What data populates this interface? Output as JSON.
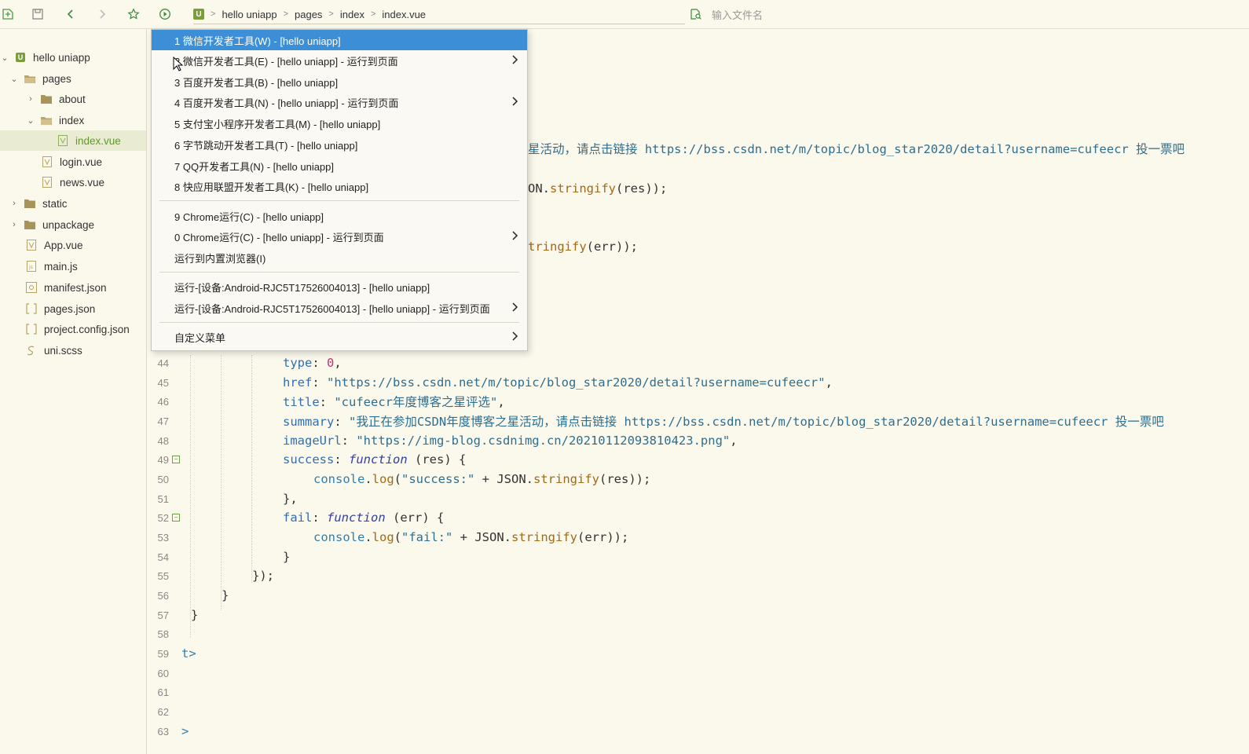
{
  "toolbar": {
    "breadcrumb": [
      "hello uniapp",
      "pages",
      "index",
      "index.vue"
    ],
    "file_search_placeholder": "输入文件名"
  },
  "sidebar": {
    "items": [
      {
        "label": "hello uniapp"
      },
      {
        "label": "pages"
      },
      {
        "label": "about"
      },
      {
        "label": "index"
      },
      {
        "label": "index.vue"
      },
      {
        "label": "login.vue"
      },
      {
        "label": "news.vue"
      },
      {
        "label": "static"
      },
      {
        "label": "unpackage"
      },
      {
        "label": "App.vue"
      },
      {
        "label": "main.js"
      },
      {
        "label": "manifest.json"
      },
      {
        "label": "pages.json"
      },
      {
        "label": "project.config.json"
      },
      {
        "label": "uni.scss"
      }
    ]
  },
  "menu": {
    "items": [
      {
        "label": "1 微信开发者工具(W) - [hello uniapp]"
      },
      {
        "label": "2 微信开发者工具(E) - [hello uniapp] - 运行到页面"
      },
      {
        "label": "3 百度开发者工具(B) - [hello uniapp]"
      },
      {
        "label": "4 百度开发者工具(N) - [hello uniapp] - 运行到页面"
      },
      {
        "label": "5 支付宝小程序开发者工具(M) - [hello uniapp]"
      },
      {
        "label": "6 字节跳动开发者工具(T) - [hello uniapp]"
      },
      {
        "label": "7 QQ开发者工具(N) - [hello uniapp]"
      },
      {
        "label": "8 快应用联盟开发者工具(K) - [hello uniapp]"
      },
      {
        "label": "9 Chrome运行(C) - [hello uniapp]"
      },
      {
        "label": "0 Chrome运行(C) - [hello uniapp] - 运行到页面"
      },
      {
        "label": "运行到内置浏览器(I)"
      },
      {
        "label": "运行-[设备:Android-RJC5T17526004013] - [hello uniapp]"
      },
      {
        "label": "运行-[设备:Android-RJC5T17526004013] - [hello uniapp] - 运行到页面"
      },
      {
        "label": "自定义菜单"
      }
    ]
  },
  "editor": {
    "partial": {
      "line1": "星活动，请点击链接 https://bss.csdn.net/m/topic/blog_star2020/detail?username=cufeecr 投一票吧",
      "line2a": "ON.",
      "line2b": "stringify",
      "line2c": "(res));",
      "line3a": "tringify",
      "line3b": "(err));"
    },
    "line_numbers": [
      "44",
      "45",
      "46",
      "47",
      "48",
      "49",
      "50",
      "51",
      "52",
      "53",
      "54",
      "55",
      "56",
      "57",
      "58",
      "59",
      "60",
      "61",
      "62",
      "63"
    ],
    "code": {
      "l44_key": "type",
      "l44_val": "0",
      "l45_key": "href",
      "l45_val": "\"https://bss.csdn.net/m/topic/blog_star2020/detail?username=cufeecr\"",
      "l46_key": "title",
      "l46_val": "\"cufeecr年度博客之星评选\"",
      "l47_key": "summary",
      "l47_val": "\"我正在参加CSDN年度博客之星活动，请点击链接 https://bss.csdn.net/m/topic/blog_star2020/detail?username=cufeecr 投一票吧",
      "l48_key": "imageUrl",
      "l48_val": "\"https://img-blog.csdnimg.cn/20210112093810423.png\"",
      "l49_key": "success",
      "l49_fn": "function",
      "l49_rest": " (res) {",
      "l50_console": "console",
      "l50_log": "log",
      "l50_str": "\"success:\"",
      "l50_json": "JSON",
      "l50_stringify": "stringify",
      "l50_rest": "(res));",
      "l51": "},",
      "l52_key": "fail",
      "l52_fn": "function",
      "l52_rest": " (err) {",
      "l53_console": "console",
      "l53_log": "log",
      "l53_str": "\"fail:\"",
      "l53_json": "JSON",
      "l53_stringify": "stringify",
      "l53_rest": "(err));",
      "l54": "}",
      "l55": "});",
      "l56": "}",
      "l57": "}",
      "l59": "t>",
      "l63": ">"
    }
  }
}
